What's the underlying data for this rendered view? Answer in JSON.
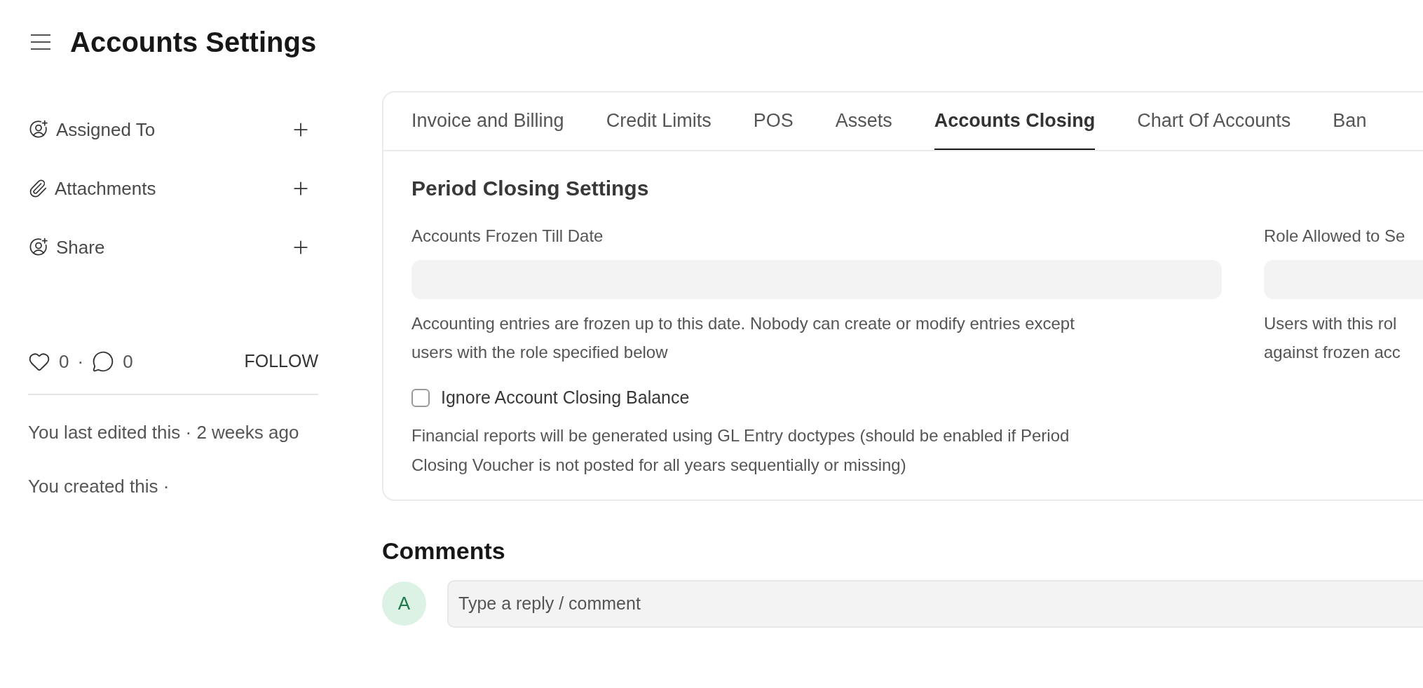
{
  "header": {
    "title": "Accounts Settings"
  },
  "sidebar": {
    "actions": [
      {
        "label": "Assigned To",
        "kind": "assign"
      },
      {
        "label": "Attachments",
        "kind": "attach"
      },
      {
        "label": "Share",
        "kind": "share"
      }
    ],
    "likes": "0",
    "separator": "·",
    "comments_count": "0",
    "follow": "FOLLOW",
    "activity": [
      "You last edited this · 2 weeks ago",
      "You created this ·"
    ]
  },
  "tabs": [
    {
      "label": "Invoice and Billing",
      "selected": false
    },
    {
      "label": "Credit Limits",
      "selected": false
    },
    {
      "label": "POS",
      "selected": false
    },
    {
      "label": "Assets",
      "selected": false
    },
    {
      "label": "Accounts Closing",
      "selected": true
    },
    {
      "label": "Chart Of Accounts",
      "selected": false
    },
    {
      "label": "Ban",
      "selected": false
    }
  ],
  "section": {
    "title": "Period Closing Settings",
    "fields": [
      {
        "label": "Accounts Frozen Till Date",
        "description_lines": [
          "Accounting entries are frozen up to this date. Nobody can create or modify entries except",
          "users with the role specified below"
        ]
      },
      {
        "label": "Role Allowed to Se",
        "description_lines": [
          "Users with this rol",
          "against frozen acc"
        ]
      }
    ],
    "checkbox": {
      "label": "Ignore Account Closing Balance",
      "checked": false,
      "description_lines": [
        "Financial reports will be generated using GL Entry doctypes (should be enabled if Period",
        "Closing Voucher is not posted for all years sequentially or missing)"
      ]
    }
  },
  "comments": {
    "title": "Comments",
    "avatar": "A",
    "placeholder": "Type a reply / comment"
  }
}
